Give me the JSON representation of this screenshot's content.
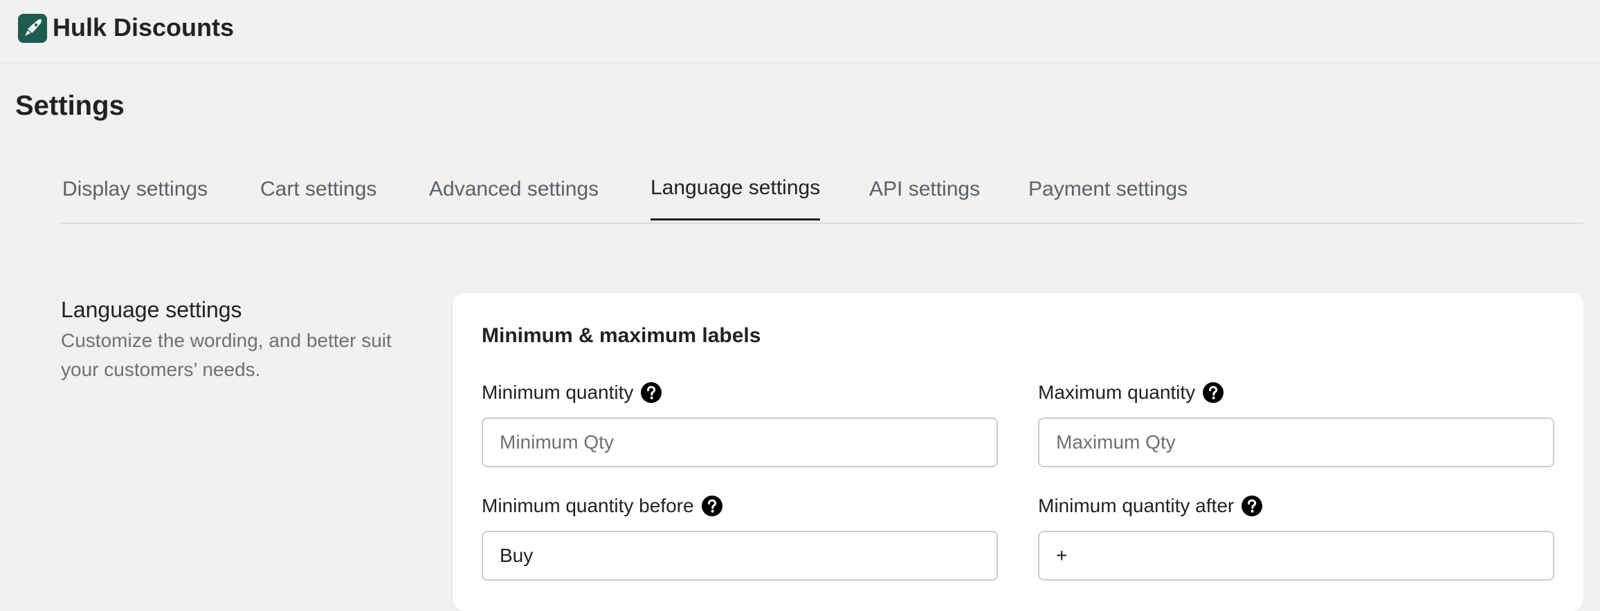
{
  "app": {
    "title": "Hulk Discounts",
    "logo_icon": "rocket-icon",
    "accent_color": "#1f5c4f"
  },
  "page": {
    "title": "Settings"
  },
  "tabs": [
    {
      "label": "Display settings",
      "active": false
    },
    {
      "label": "Cart settings",
      "active": false
    },
    {
      "label": "Advanced settings",
      "active": false
    },
    {
      "label": "Language settings",
      "active": true
    },
    {
      "label": "API settings",
      "active": false
    },
    {
      "label": "Payment settings",
      "active": false
    }
  ],
  "section": {
    "title": "Language settings",
    "description": "Customize the wording, and better suit your customers’ needs."
  },
  "card": {
    "title": "Minimum & maximum labels",
    "fields": [
      {
        "label": "Minimum quantity",
        "value": "",
        "placeholder": "Minimum Qty",
        "help_icon": "question-circle-icon"
      },
      {
        "label": "Maximum quantity",
        "value": "",
        "placeholder": "Maximum Qty",
        "help_icon": "question-circle-icon"
      },
      {
        "label": "Minimum quantity before",
        "value": "Buy",
        "placeholder": "",
        "help_icon": "question-circle-icon"
      },
      {
        "label": "Minimum quantity after",
        "value": "+",
        "placeholder": "",
        "help_icon": "question-circle-icon"
      }
    ]
  }
}
